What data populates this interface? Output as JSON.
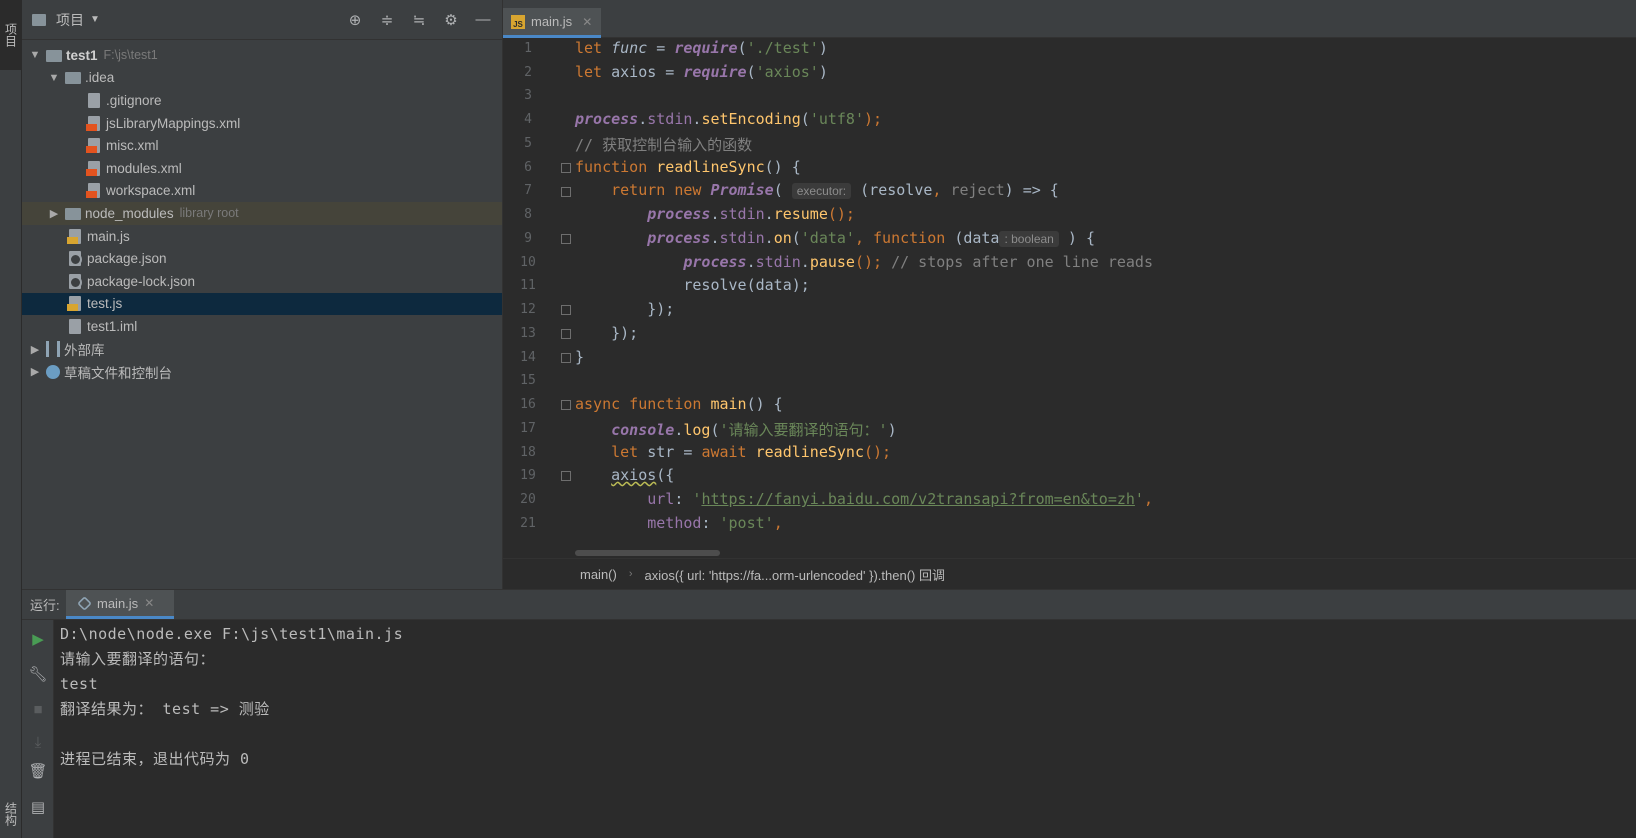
{
  "left_strip": {
    "project_tab": "项目",
    "structure_tab": "结构"
  },
  "project_panel": {
    "title": "项目",
    "tree": [
      {
        "label": "test1",
        "hint": "F:\\js\\test1"
      },
      {
        "label": ".idea"
      },
      {
        "label": ".gitignore"
      },
      {
        "label": "jsLibraryMappings.xml"
      },
      {
        "label": "misc.xml"
      },
      {
        "label": "modules.xml"
      },
      {
        "label": "workspace.xml"
      },
      {
        "label": "node_modules",
        "hint": "library root"
      },
      {
        "label": "main.js"
      },
      {
        "label": "package.json"
      },
      {
        "label": "package-lock.json"
      },
      {
        "label": "test.js"
      },
      {
        "label": "test1.iml"
      },
      {
        "label": "外部库"
      },
      {
        "label": "草稿文件和控制台"
      }
    ]
  },
  "editor": {
    "tab": "main.js",
    "line_numbers": [
      "1",
      "2",
      "3",
      "4",
      "5",
      "6",
      "7",
      "8",
      "9",
      "10",
      "11",
      "12",
      "13",
      "14",
      "15",
      "16",
      "17",
      "18",
      "19",
      "20",
      "21"
    ],
    "hints": {
      "executor": "executor:",
      "boolean": ": boolean"
    },
    "code": {
      "l1_a": "let ",
      "l1_b": "func",
      "l1_c": " = ",
      "l1_d": "require",
      "l1_e": "(",
      "l1_f": "'./test'",
      "l1_g": ")",
      "l2_a": "let ",
      "l2_b": "axios = ",
      "l2_d": "require",
      "l2_e": "(",
      "l2_f": "'axios'",
      "l2_g": ")",
      "l4_a": "process",
      "l4_b": ".",
      "l4_c": "stdin",
      "l4_d": ".",
      "l4_e": "setEncoding",
      "l4_f": "(",
      "l4_g": "'utf8'",
      "l4_h": ");",
      "l5": "// 获取控制台输入的函数",
      "l6_a": "function ",
      "l6_b": "readlineSync",
      "l6_c": "() {",
      "l7_a": "    return new ",
      "l7_b": "Promise",
      "l7_c": "( ",
      "l7_d": " (resolve",
      "l7_e": ", ",
      "l7_f": "reject",
      "l7_g": ") => {",
      "l8_a": "        ",
      "l8_b": "process",
      "l8_c": ".",
      "l8_d": "stdin",
      "l8_e": ".",
      "l8_f": "resume",
      "l8_g": "();",
      "l9_a": "        ",
      "l9_b": "process",
      "l9_c": ".",
      "l9_d": "stdin",
      "l9_e": ".",
      "l9_f": "on",
      "l9_g": "(",
      "l9_h": "'data'",
      "l9_i": ", ",
      "l9_j": "function ",
      "l9_k": "(data",
      "l9_l": " ) {",
      "l10_a": "            ",
      "l10_b": "process",
      "l10_c": ".",
      "l10_d": "stdin",
      "l10_e": ".",
      "l10_f": "pause",
      "l10_g": "(); ",
      "l10_h": "// stops after one line reads",
      "l11": "            resolve(data);",
      "l12": "        });",
      "l13": "    });",
      "l14": "}",
      "l16_a": "async function ",
      "l16_b": "main",
      "l16_c": "() {",
      "l17_a": "    ",
      "l17_b": "console",
      "l17_c": ".",
      "l17_d": "log",
      "l17_e": "(",
      "l17_f": "'请输入要翻译的语句：'",
      "l17_g": ")",
      "l18_a": "    let ",
      "l18_b": "str = ",
      "l18_c": "await ",
      "l18_d": "readlineSync",
      "l18_e": "();",
      "l19_a": "    ",
      "l19_b": "axios",
      "l19_c": "({",
      "l20_a": "        ",
      "l20_b": "url",
      "l20_c": ": ",
      "l20_d": "'",
      "l20_e": "https://fanyi.baidu.com/v2transapi?from=en&to=zh",
      "l20_f": "'",
      "l20_g": ",",
      "l21_a": "        ",
      "l21_b": "method",
      "l21_c": ": ",
      "l21_d": "'post'",
      "l21_e": ","
    }
  },
  "breadcrumb": {
    "item1": "main()",
    "item2": "axios({ url: 'https://fa...orm-urlencoded' }).then() 回调"
  },
  "run_panel": {
    "label": "运行:",
    "tab": "main.js",
    "console": [
      "D:\\node\\node.exe F:\\js\\test1\\main.js",
      "请输入要翻译的语句：",
      "test",
      "翻译结果为： test => 测验",
      "",
      "进程已结束，退出代码为 0"
    ]
  }
}
